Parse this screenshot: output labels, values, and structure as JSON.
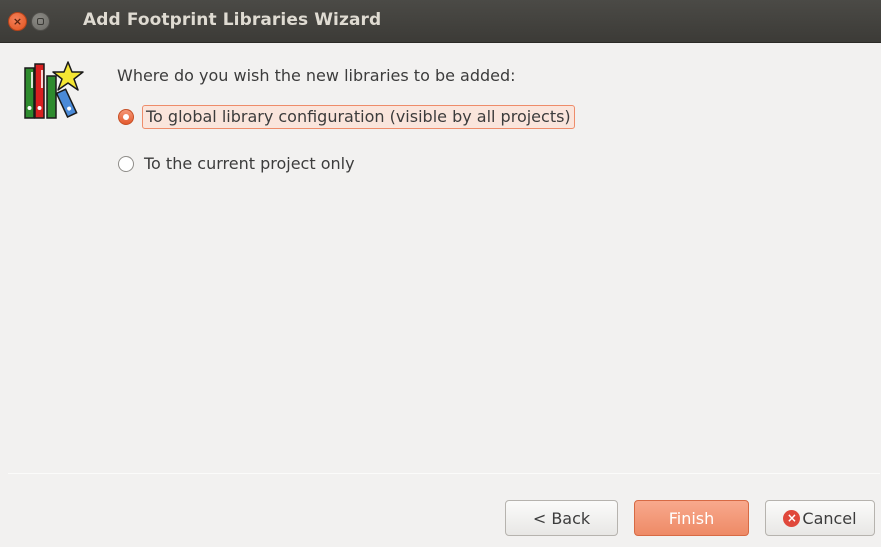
{
  "window": {
    "title": "Add Footprint Libraries Wizard",
    "close_glyph": "×",
    "icon": "footprint-libraries-wizard-icon"
  },
  "prompt": {
    "question": "Where do you wish the new libraries to be added:"
  },
  "options": [
    {
      "label": "To global library configuration (visible by all projects)",
      "selected": true
    },
    {
      "label": "To the current project only",
      "selected": false
    }
  ],
  "buttons": {
    "back_label": "< Back",
    "finish_label": "Finish",
    "cancel_label": "Cancel",
    "cancel_glyph": "×"
  },
  "colors": {
    "accent": "#ee8a66",
    "titlebar": "#3c3b37",
    "window_bg": "#f2f1f0"
  }
}
